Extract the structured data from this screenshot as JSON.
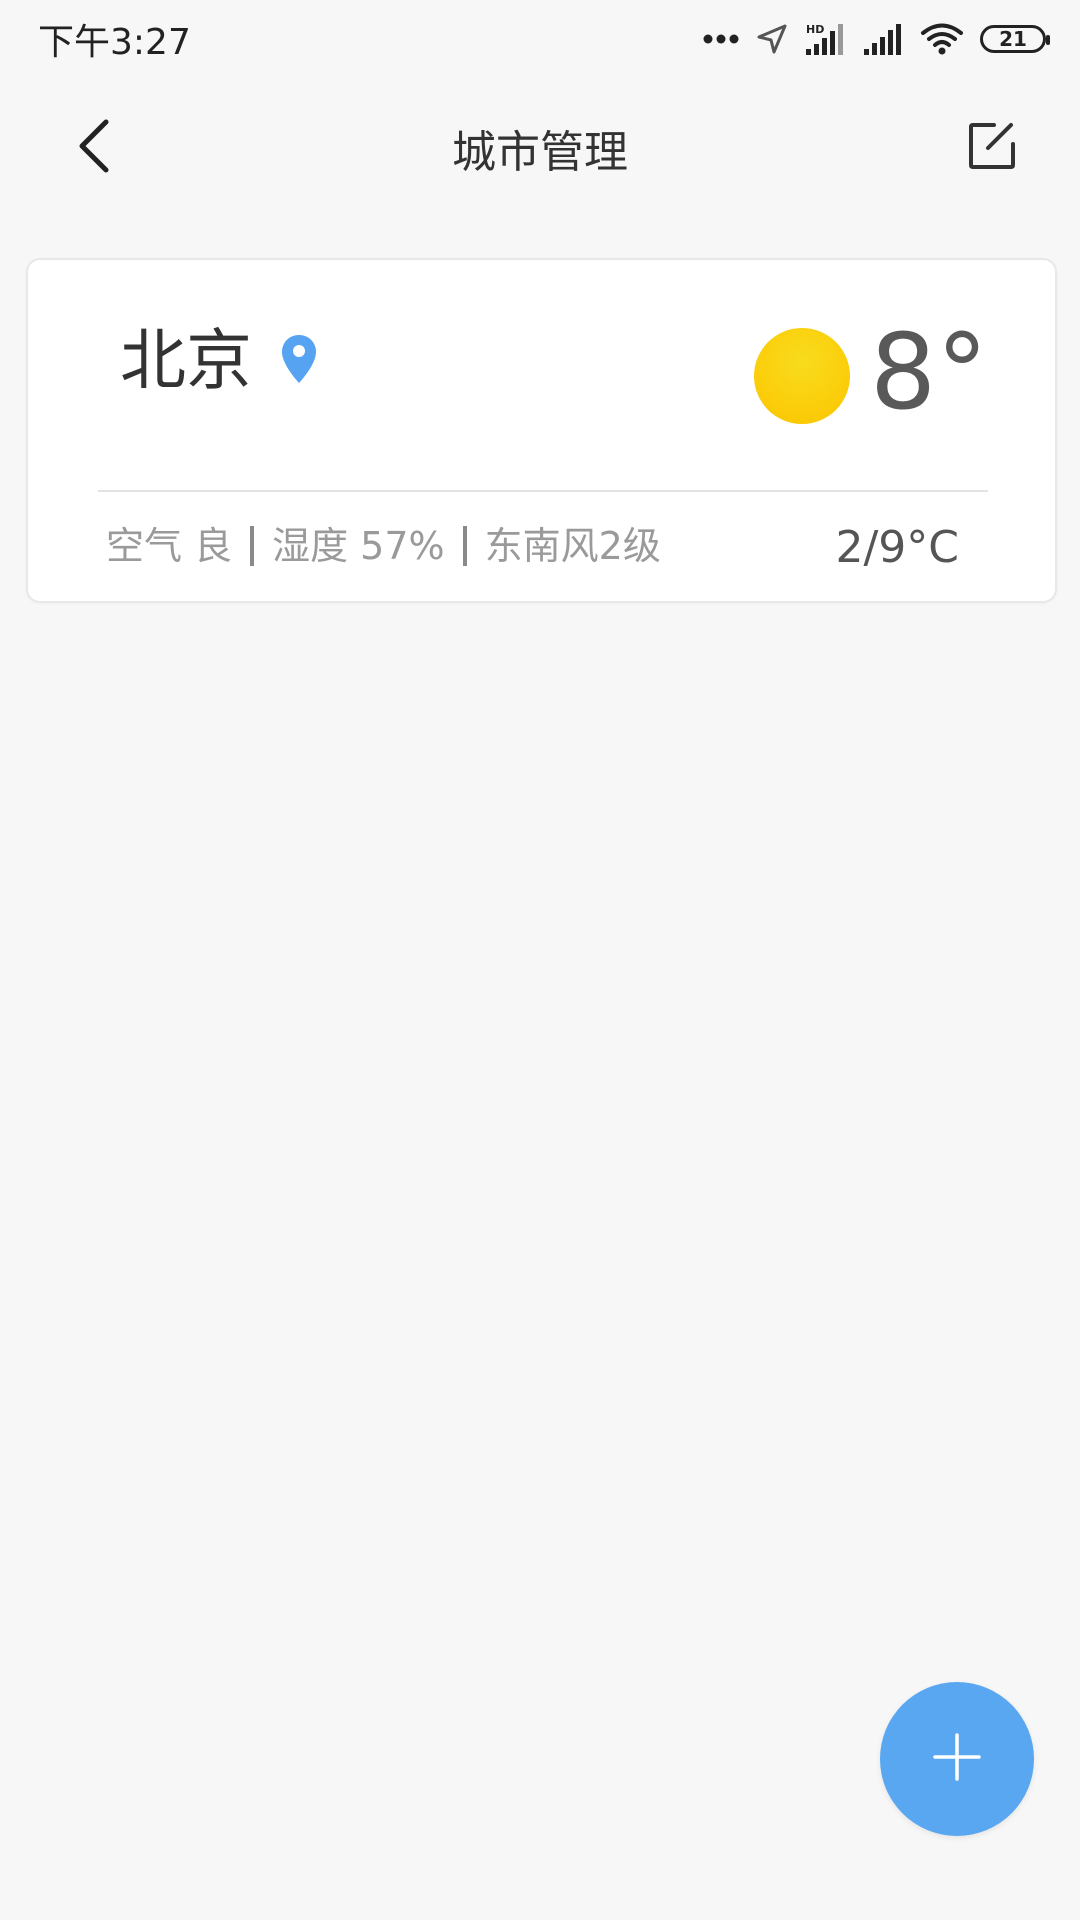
{
  "status_bar": {
    "time": "下午3:27",
    "battery_level": "21",
    "icons": [
      "more-dots-icon",
      "location-arrow-icon",
      "hd-signal-icon",
      "cell-signal-icon",
      "wifi-icon",
      "battery-icon"
    ]
  },
  "app_bar": {
    "title": "城市管理",
    "back_icon": "chevron-left-icon",
    "edit_icon": "edit-square-icon"
  },
  "cities": [
    {
      "name": "北京",
      "location_icon": "location-pin-icon",
      "weather_icon": "sun-icon",
      "temperature": "8°",
      "air": "空气 良",
      "humidity": "湿度 57%",
      "wind": "东南风2级",
      "temp_range": "2/9°C"
    }
  ],
  "fab": {
    "icon": "plus-icon"
  },
  "colors": {
    "accent": "#5aa7f1",
    "sun": "#fbcf0c",
    "background": "#f7f7f7",
    "card": "#ffffff"
  }
}
